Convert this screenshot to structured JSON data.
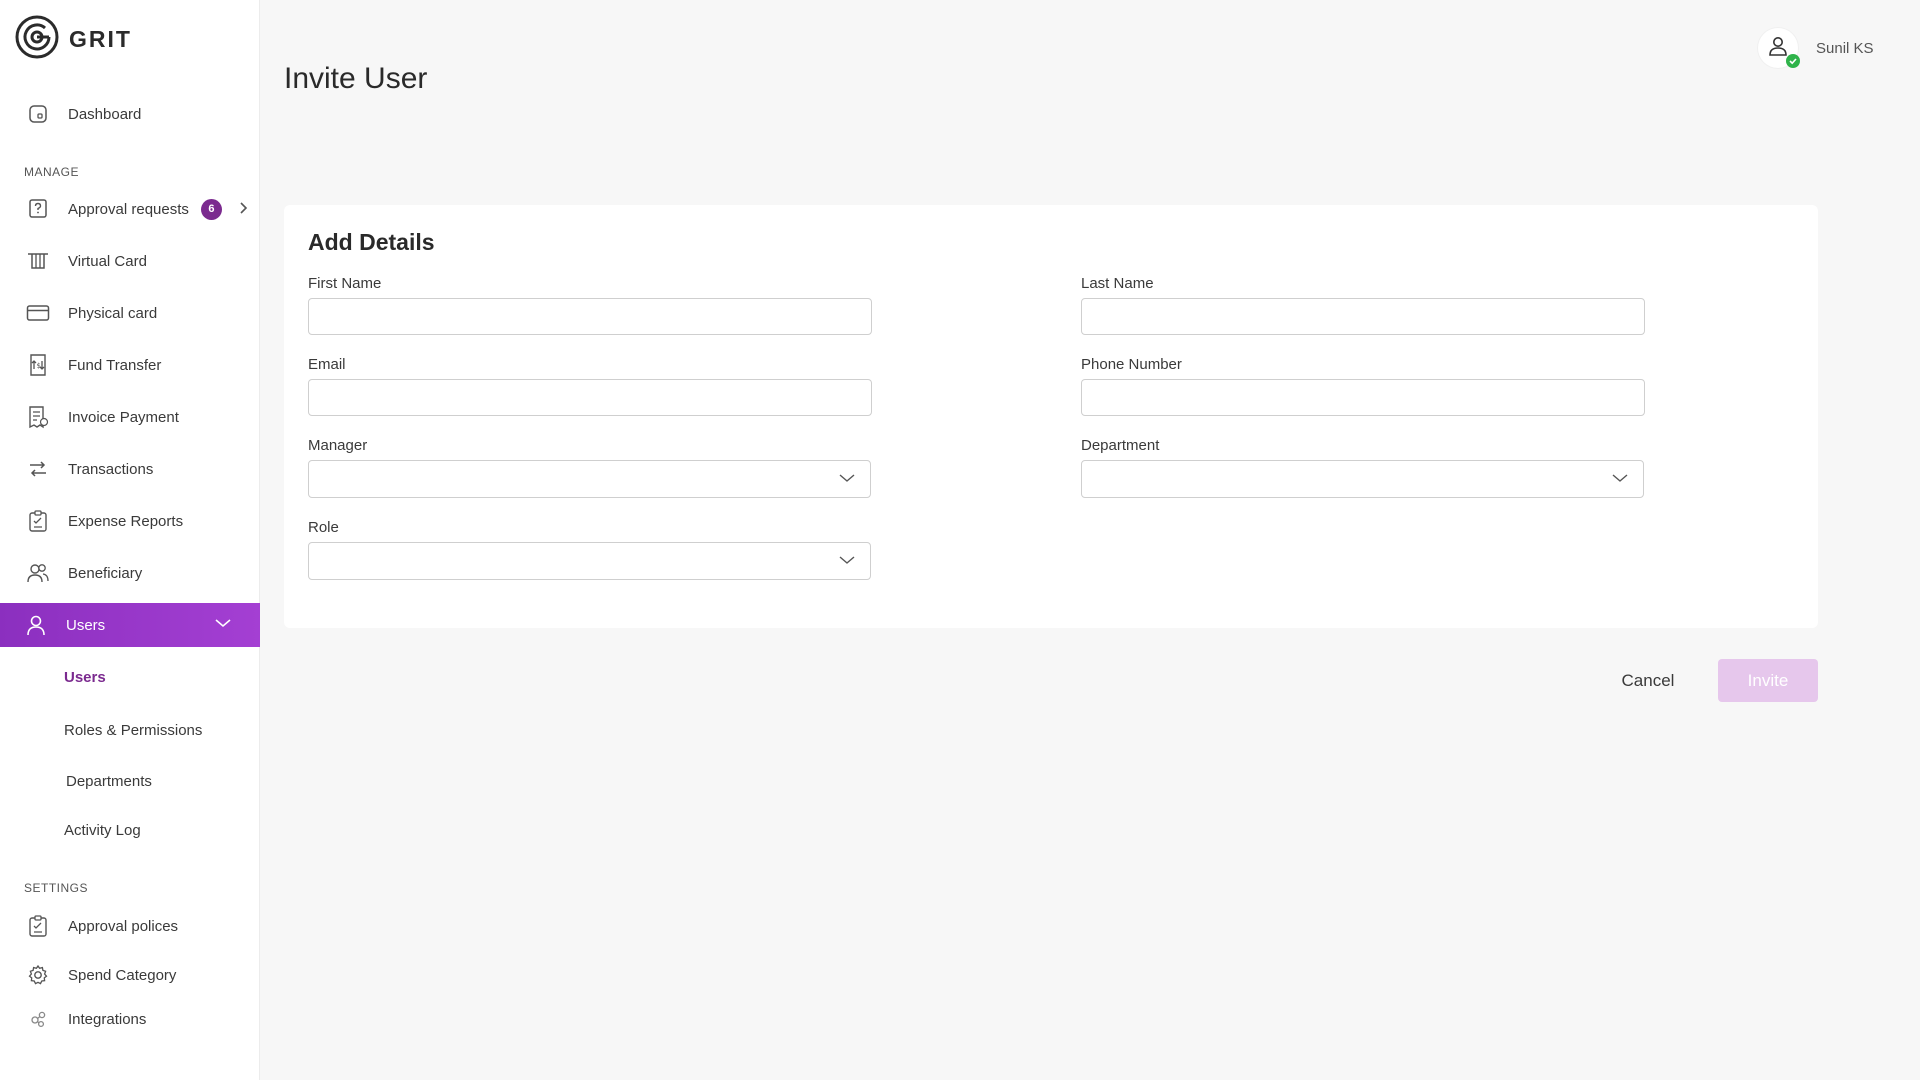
{
  "brand": {
    "name": "GRIT"
  },
  "sidebar": {
    "dashboard": {
      "label": "Dashboard",
      "icon": "dashboard-icon"
    },
    "manage_label": "MANAGE",
    "manage_items": [
      {
        "label": "Approval requests",
        "icon": "approval-request-icon",
        "badge": "6"
      },
      {
        "label": "Virtual Card",
        "icon": "virtual-card-icon"
      },
      {
        "label": "Physical card",
        "icon": "credit-card-icon"
      },
      {
        "label": "Fund Transfer",
        "icon": "fund-transfer-icon"
      },
      {
        "label": "Invoice Payment",
        "icon": "invoice-icon"
      },
      {
        "label": "Transactions",
        "icon": "transactions-icon"
      },
      {
        "label": "Expense Reports",
        "icon": "expense-report-icon"
      },
      {
        "label": "Beneficiary",
        "icon": "beneficiary-icon"
      }
    ],
    "users_group": {
      "label": "Users",
      "icon": "user-icon",
      "sub_items": [
        {
          "label": "Users",
          "selected": true
        },
        {
          "label": "Roles & Permissions"
        },
        {
          "label": "Departments"
        },
        {
          "label": "Activity Log"
        }
      ]
    },
    "settings_label": "SETTINGS",
    "settings_items": [
      {
        "label": "Approval polices",
        "icon": "clipboard-check-icon"
      },
      {
        "label": "Spend Category",
        "icon": "gear-icon"
      },
      {
        "label": "Integrations",
        "icon": "integrations-icon"
      }
    ]
  },
  "header": {
    "title": "Invite User",
    "user_name": "Sunil KS"
  },
  "form": {
    "title": "Add Details",
    "first_name": {
      "label": "First Name",
      "value": "",
      "placeholder": ""
    },
    "last_name": {
      "label": "Last Name",
      "value": "",
      "placeholder": ""
    },
    "email": {
      "label": "Email",
      "value": "",
      "placeholder": ""
    },
    "phone": {
      "label": "Phone Number",
      "value": "",
      "placeholder": ""
    },
    "manager": {
      "label": "Manager",
      "value": ""
    },
    "department": {
      "label": "Department",
      "value": ""
    },
    "role": {
      "label": "Role",
      "value": ""
    }
  },
  "actions": {
    "cancel_label": "Cancel",
    "invite_label": "Invite"
  },
  "colors": {
    "accent": "#7b2a8f",
    "active_nav_start": "#8b2fbf",
    "active_nav_end": "#a43fd3",
    "invite_disabled": "#e6c7ec",
    "online": "#2fb34a"
  }
}
